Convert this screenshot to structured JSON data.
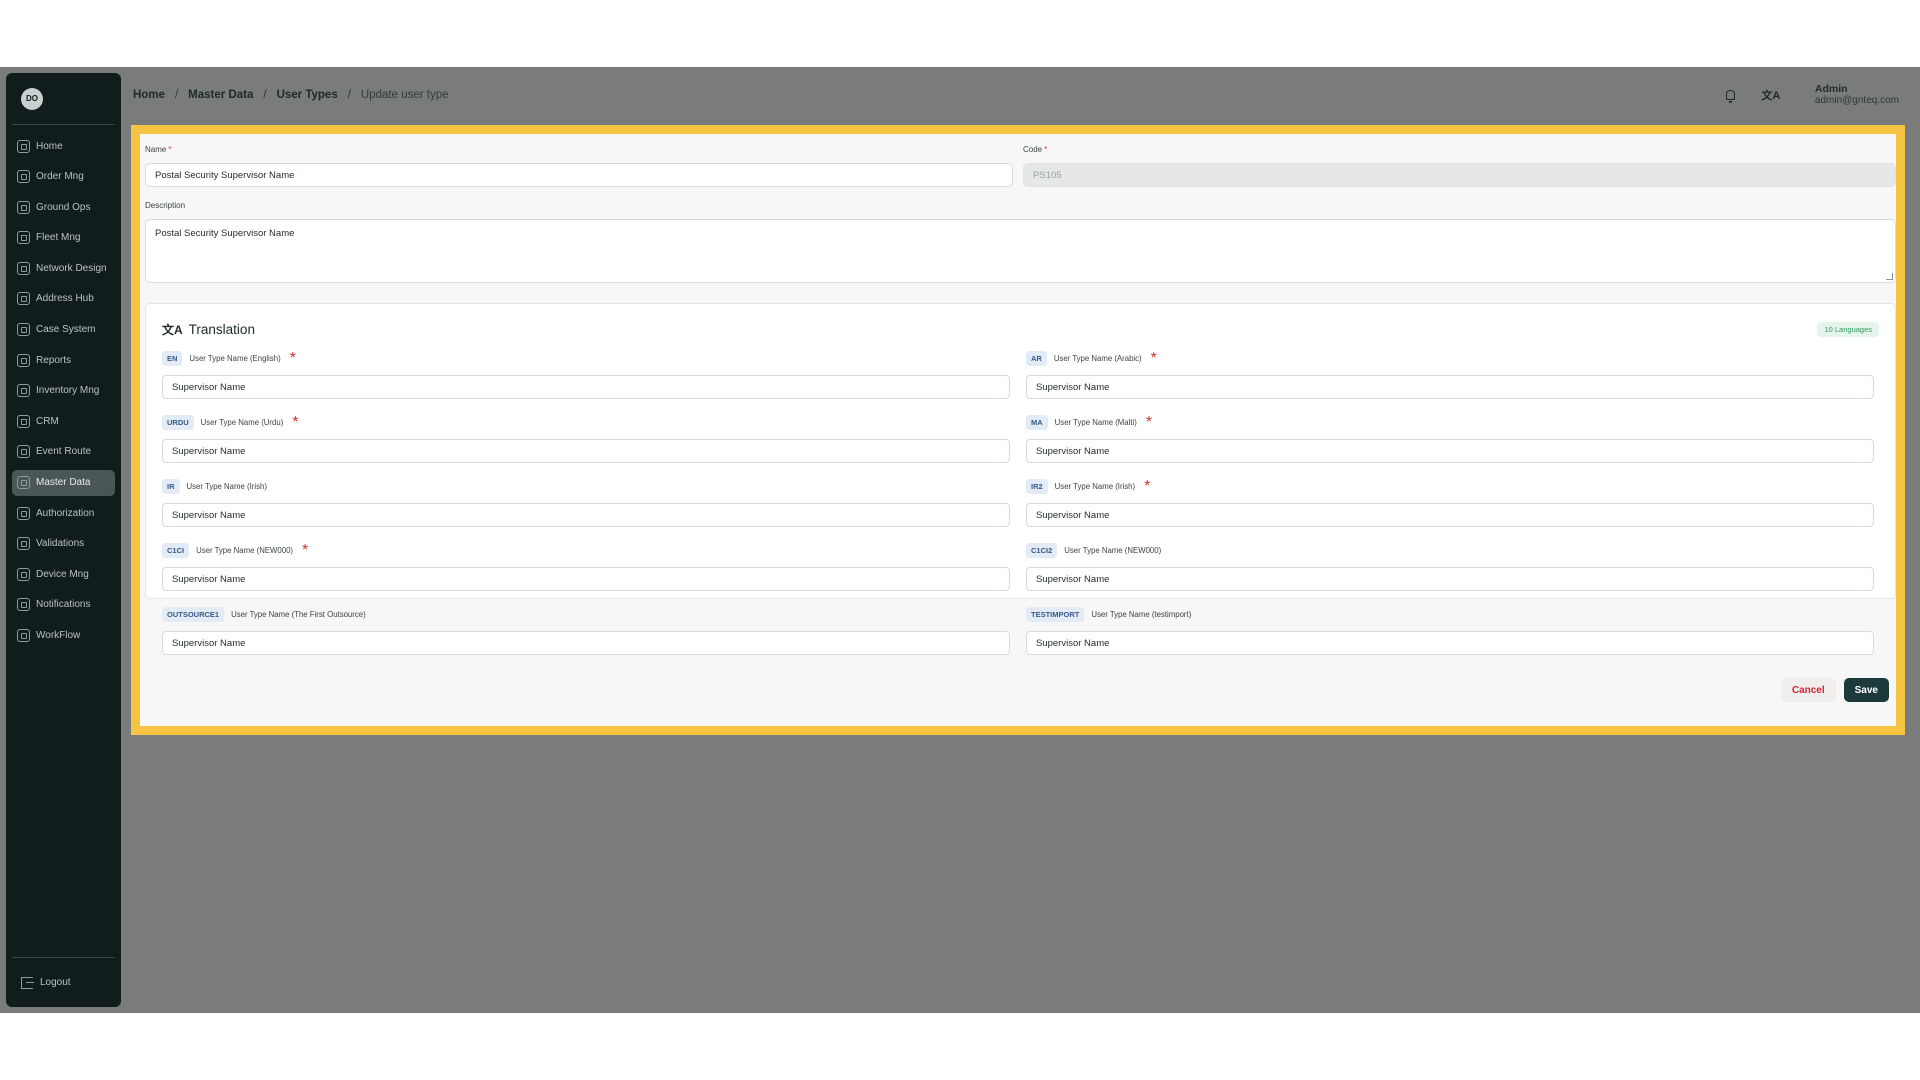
{
  "sidebar": {
    "logo": "DO",
    "items": [
      {
        "label": "Home",
        "icon": "home-icon"
      },
      {
        "label": "Order Mng",
        "icon": "order-icon"
      },
      {
        "label": "Ground Ops",
        "icon": "ground-ops-icon"
      },
      {
        "label": "Fleet Mng",
        "icon": "fleet-icon"
      },
      {
        "label": "Network Design",
        "icon": "network-icon"
      },
      {
        "label": "Address Hub",
        "icon": "address-icon"
      },
      {
        "label": "Case System",
        "icon": "case-icon"
      },
      {
        "label": "Reports",
        "icon": "reports-icon"
      },
      {
        "label": "Inventory Mng",
        "icon": "inventory-icon"
      },
      {
        "label": "CRM",
        "icon": "crm-icon"
      },
      {
        "label": "Event Route",
        "icon": "event-route-icon"
      },
      {
        "label": "Master Data",
        "icon": "database-icon",
        "active": true
      },
      {
        "label": "Authorization",
        "icon": "users-icon"
      },
      {
        "label": "Validations",
        "icon": "validations-icon"
      },
      {
        "label": "Device Mng",
        "icon": "device-icon"
      },
      {
        "label": "Notifications",
        "icon": "bell-icon"
      },
      {
        "label": "WorkFlow",
        "icon": "workflow-icon"
      }
    ],
    "logout": "Logout"
  },
  "breadcrumb": {
    "home": "Home",
    "master_data": "Master Data",
    "user_types": "User Types",
    "current": "Update user type",
    "separator": "/"
  },
  "topbar": {
    "translate_glyph": "文A",
    "user_name": "Admin",
    "user_email": "admin@gnteq.com"
  },
  "form": {
    "name_label": "Name",
    "name_value": "Postal Security Supervisor Name",
    "code_label": "Code",
    "code_value": "PS105",
    "required_mark": "*",
    "description_label": "Description",
    "description_value": "Postal Security Supervisor Name"
  },
  "translation": {
    "icon_glyph": "文A",
    "title": "Translation",
    "badge": "10 Languages",
    "fields": [
      {
        "code": "EN",
        "label": "User Type Name (English)",
        "required": true,
        "value": "Supervisor Name"
      },
      {
        "code": "AR",
        "label": "User Type Name (Arabic)",
        "required": true,
        "value": "Supervisor Name"
      },
      {
        "code": "URDU",
        "label": "User Type Name (Urdu)",
        "required": true,
        "value": "Supervisor Name"
      },
      {
        "code": "MA",
        "label": "User Type Name (Malti)",
        "required": true,
        "value": "Supervisor Name"
      },
      {
        "code": "IR",
        "label": "User Type Name (Irish)",
        "required": false,
        "value": "Supervisor Name"
      },
      {
        "code": "IR2",
        "label": "User Type Name (Irish)",
        "required": true,
        "value": "Supervisor Name"
      },
      {
        "code": "C1CI",
        "label": "User Type Name (NEW000)",
        "required": true,
        "value": "Supervisor Name"
      },
      {
        "code": "C1CI2",
        "label": "User Type Name (NEW000)",
        "required": false,
        "value": "Supervisor Name"
      },
      {
        "code": "OUTSOURCE1",
        "label": "User Type Name (The First Outsource)",
        "required": false,
        "value": "Supervisor Name"
      },
      {
        "code": "TESTIMPORT",
        "label": "User Type Name (testimport)",
        "required": false,
        "value": "Supervisor Name"
      }
    ]
  },
  "actions": {
    "cancel": "Cancel",
    "save": "Save"
  },
  "colors": {
    "sidebar_bg": "#111c1c",
    "highlight": "#f5c443",
    "save_bg": "#1c3a3c",
    "cancel_text": "#d3263a",
    "badge_text": "#2f9a5b"
  }
}
